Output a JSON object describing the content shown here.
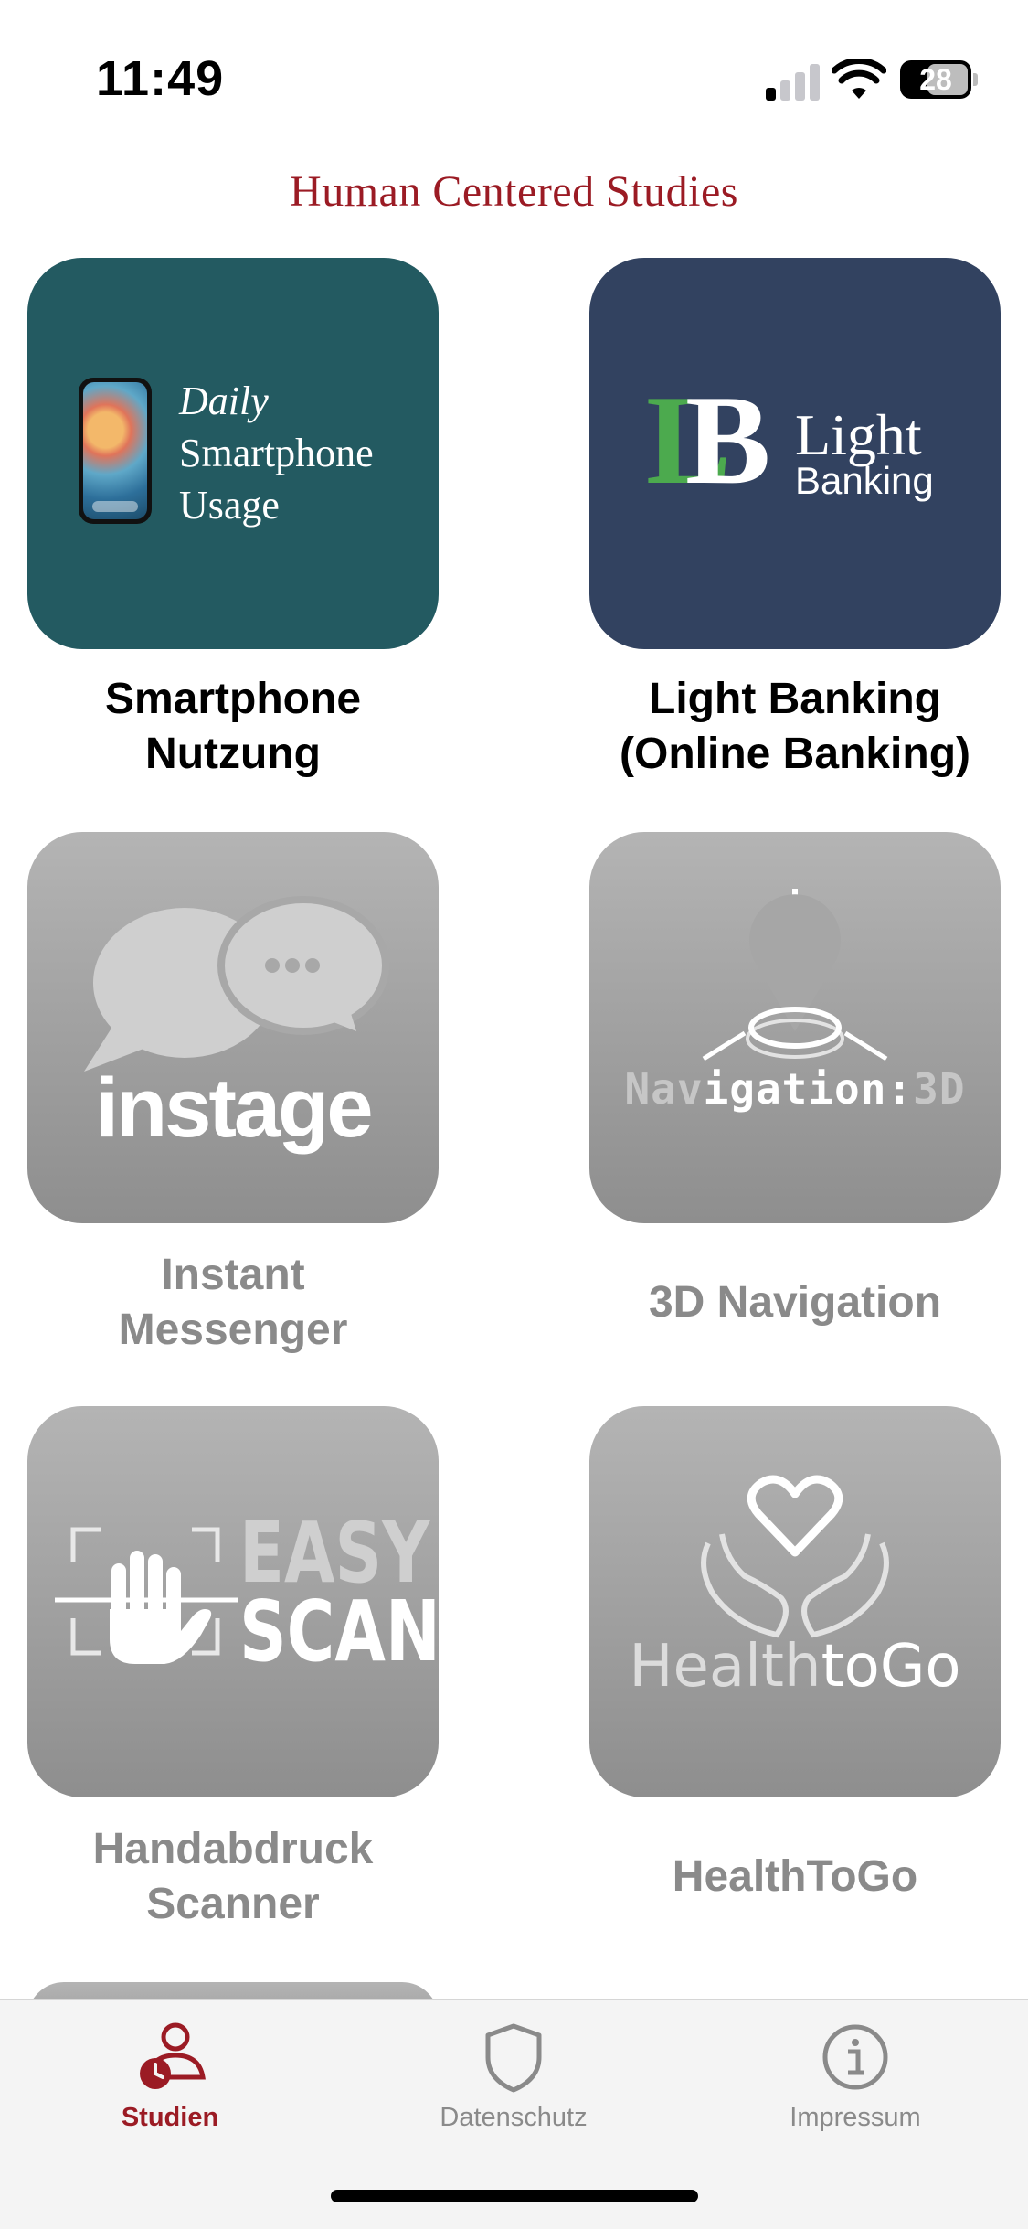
{
  "status_bar": {
    "time": "11:49",
    "battery": "28"
  },
  "header": {
    "title": "Human Centered Studies"
  },
  "studies": [
    {
      "logo_lines": [
        "Daily",
        "Smartphone",
        "Usage"
      ],
      "label_lines": [
        "Smartphone",
        "Nutzung"
      ],
      "active": true
    },
    {
      "logo_mark": [
        "L",
        "B"
      ],
      "logo_lines": [
        "Light",
        "Banking"
      ],
      "label_lines": [
        "Light Banking",
        "(Online Banking)"
      ],
      "active": true
    },
    {
      "logo_text": "instage",
      "label_lines": [
        "Instant",
        "Messenger"
      ],
      "active": false
    },
    {
      "logo_parts": [
        "Nav",
        "igation:",
        "3D"
      ],
      "label_lines": [
        "3D Navigation"
      ],
      "active": false
    },
    {
      "logo_lines": [
        "EASY",
        "SCAN"
      ],
      "label_lines": [
        "Handabdruck",
        "Scanner"
      ],
      "active": false
    },
    {
      "logo_parts": [
        "Health",
        "toGo"
      ],
      "label_lines": [
        "HealthToGo"
      ],
      "active": false
    }
  ],
  "tab_bar": {
    "tabs": [
      {
        "label": "Studien",
        "icon": "person-clock-icon",
        "selected": true
      },
      {
        "label": "Datenschutz",
        "icon": "shield-icon",
        "selected": false
      },
      {
        "label": "Impressum",
        "icon": "info-icon",
        "selected": false
      }
    ]
  },
  "colors": {
    "accent": "#9b1b24",
    "tile_teal": "#235a61",
    "tile_navy": "#324260",
    "tile_disabled": "#a0a0a0"
  }
}
